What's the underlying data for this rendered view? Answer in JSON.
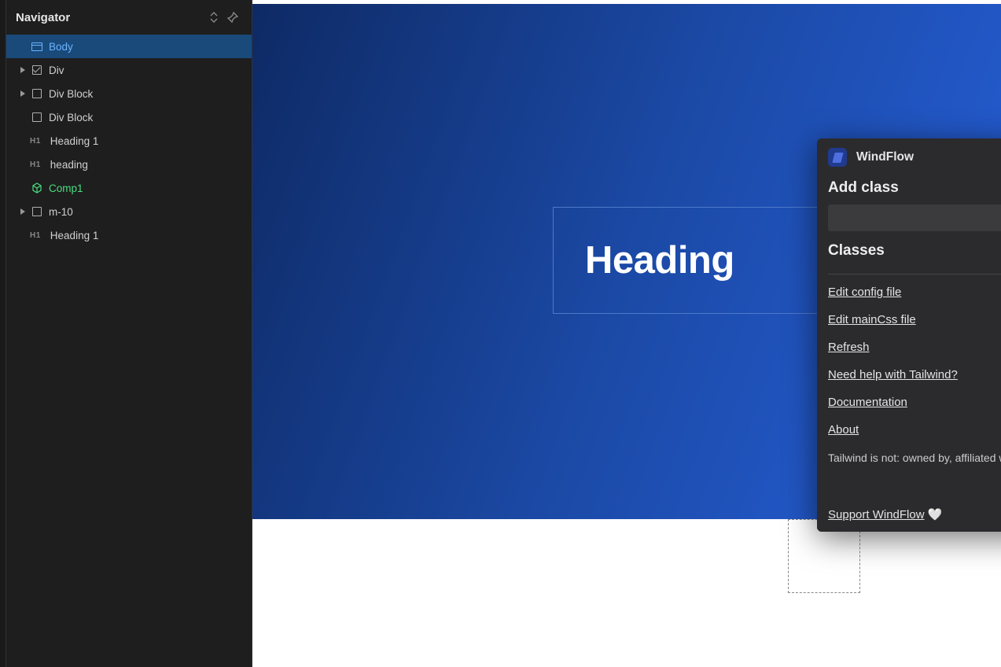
{
  "navigator": {
    "title": "Navigator",
    "items": [
      {
        "label": "Body",
        "type": "body",
        "depth": 0,
        "expandable": false,
        "selected": true,
        "component": false
      },
      {
        "label": "Div",
        "type": "check",
        "depth": 1,
        "expandable": true,
        "selected": false,
        "component": false
      },
      {
        "label": "Div Block",
        "type": "box",
        "depth": 1,
        "expandable": true,
        "selected": false,
        "component": false
      },
      {
        "label": "Div Block",
        "type": "box",
        "depth": 1,
        "expandable": false,
        "selected": false,
        "component": false
      },
      {
        "label": "Heading 1",
        "type": "h1",
        "depth": 1,
        "expandable": false,
        "selected": false,
        "component": false
      },
      {
        "label": "heading",
        "type": "h1",
        "depth": 1,
        "expandable": false,
        "selected": false,
        "component": false
      },
      {
        "label": "Comp1",
        "type": "cube",
        "depth": 1,
        "expandable": false,
        "selected": false,
        "component": true
      },
      {
        "label": "m-10",
        "type": "box",
        "depth": 1,
        "expandable": true,
        "selected": false,
        "component": false
      },
      {
        "label": "Heading 1",
        "type": "h1",
        "depth": 1,
        "expandable": false,
        "selected": false,
        "component": false
      }
    ]
  },
  "canvas": {
    "heading_text": "Heading"
  },
  "popup": {
    "title": "WindFlow",
    "add_class_heading": "Add class",
    "add_class_placeholder": "",
    "add_btn_label": "+",
    "classes_heading": "Classes",
    "links": [
      "Edit config file",
      "Edit mainCss file",
      "Refresh",
      "Need help with Tailwind?",
      "Documentation",
      "About"
    ],
    "disclaimer": "Tailwind is not: owned by, affiliated with, nor",
    "footer_label": "Support WindFlow",
    "heart": "🤍"
  }
}
